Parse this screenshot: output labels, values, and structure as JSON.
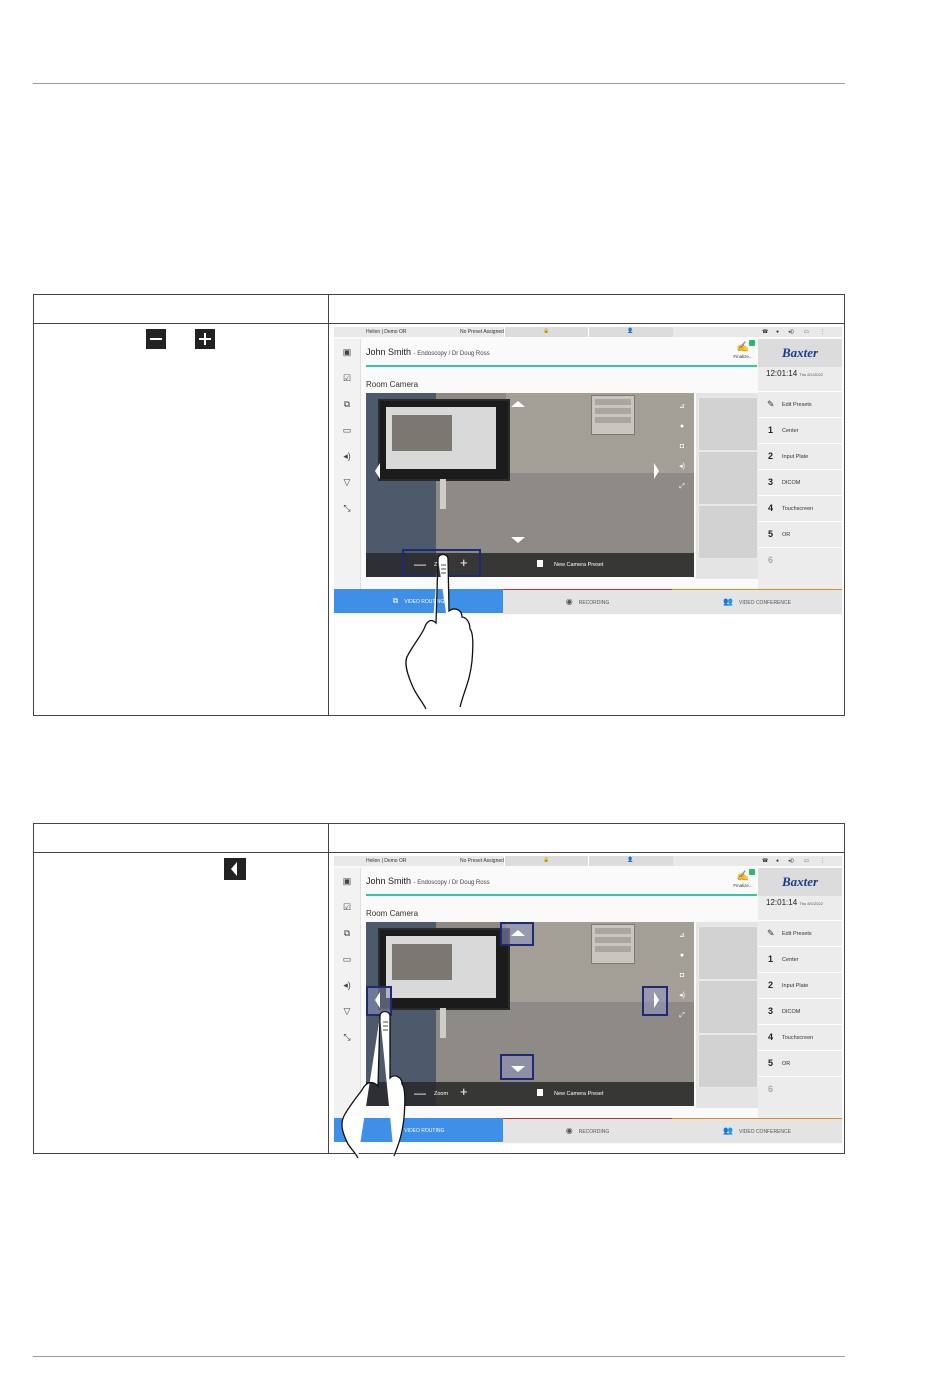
{
  "ui": {
    "topbar_left": "Helion | Demo OR",
    "topbar_preset": "No Preset Assigned",
    "patient_name": "John Smith",
    "patient_detail": "- Endoscopy / Dr Doug Ross",
    "finalize": "Finalize...",
    "brand": "Baxter",
    "time": "12:01:14",
    "date": "Thu 8/1/2022",
    "room_camera": "Room Camera",
    "edit_presets": "Edit Presets",
    "presets": [
      {
        "num": "1",
        "label": "Center"
      },
      {
        "num": "2",
        "label": "Input Plate"
      },
      {
        "num": "3",
        "label": "DICOM"
      },
      {
        "num": "4",
        "label": "Touchscreen"
      },
      {
        "num": "5",
        "label": "OR"
      },
      {
        "num": "6",
        "label": ""
      }
    ],
    "zoom_label": "Zoom",
    "minus": "—",
    "plus": "+",
    "new_camera_preset": "New Camera Preset",
    "tab_video_routing": "VIDEO ROUTING",
    "tab_recording": "RECORDING",
    "tab_video_conference": "VIDEO CONFERENCE"
  },
  "icons": {
    "step1_zoom_out": "minus-box-icon",
    "step1_zoom_in": "plus-box-icon",
    "step2_left_arrow": "left-arrow-box-icon"
  },
  "colors": {
    "accent_blue": "#3d8fe8",
    "teal_line": "#34c7a4",
    "highlight_frame": "#1f2a73",
    "brand_blue": "#1a3c8f"
  }
}
